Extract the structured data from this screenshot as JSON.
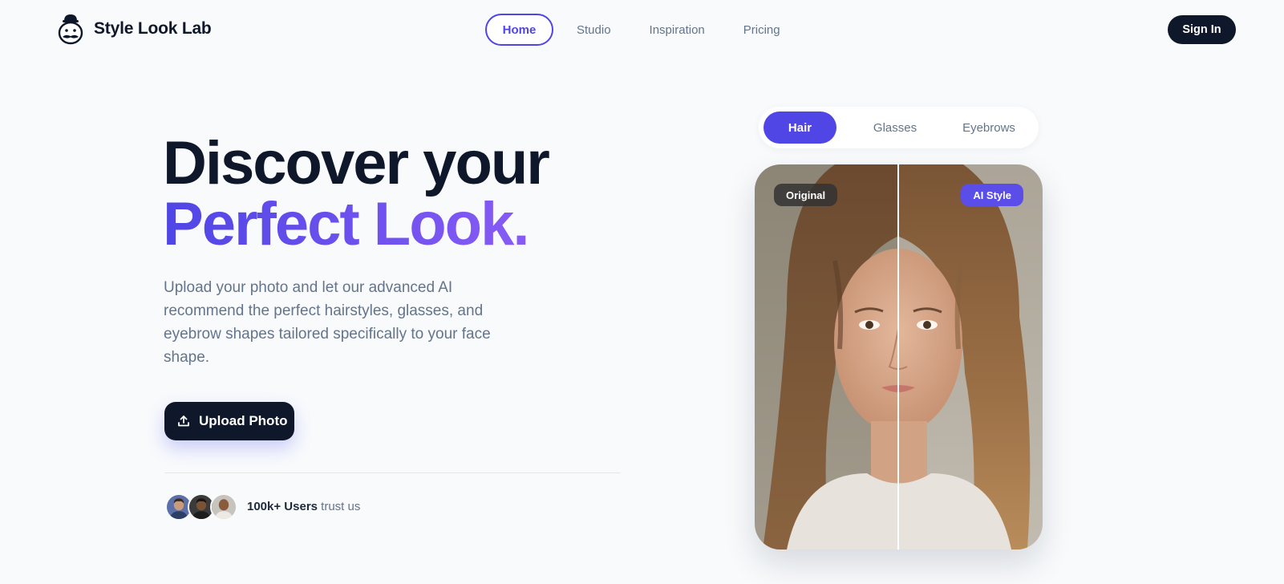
{
  "brand": {
    "name": "Style Look Lab",
    "logo_icon": "mustache-face-icon"
  },
  "nav": {
    "items": [
      {
        "label": "Home",
        "active": true
      },
      {
        "label": "Studio",
        "active": false
      },
      {
        "label": "Inspiration",
        "active": false
      },
      {
        "label": "Pricing",
        "active": false
      }
    ],
    "signin_label": "Sign In"
  },
  "hero": {
    "title_line1": "Discover your",
    "title_line2": "Perfect Look.",
    "description": "Upload your photo and let our advanced AI recommend the perfect hairstyles, glasses, and eyebrow shapes tailored specifically to your face shape.",
    "upload_label": "Upload Photo",
    "upload_icon": "upload-icon",
    "trust_strong": "100k+ Users",
    "trust_rest": "trust us"
  },
  "style_tabs": [
    {
      "label": "Hair",
      "active": true
    },
    {
      "label": "Glasses",
      "active": false
    },
    {
      "label": "Eyebrows",
      "active": false
    }
  ],
  "comparison": {
    "left_badge": "Original",
    "right_badge": "AI Style"
  },
  "colors": {
    "accent": "#4f46e5",
    "accent_gradient_end": "#8b5cf6",
    "dark": "#0f172a",
    "muted": "#64748b",
    "background": "#f8fafc"
  }
}
